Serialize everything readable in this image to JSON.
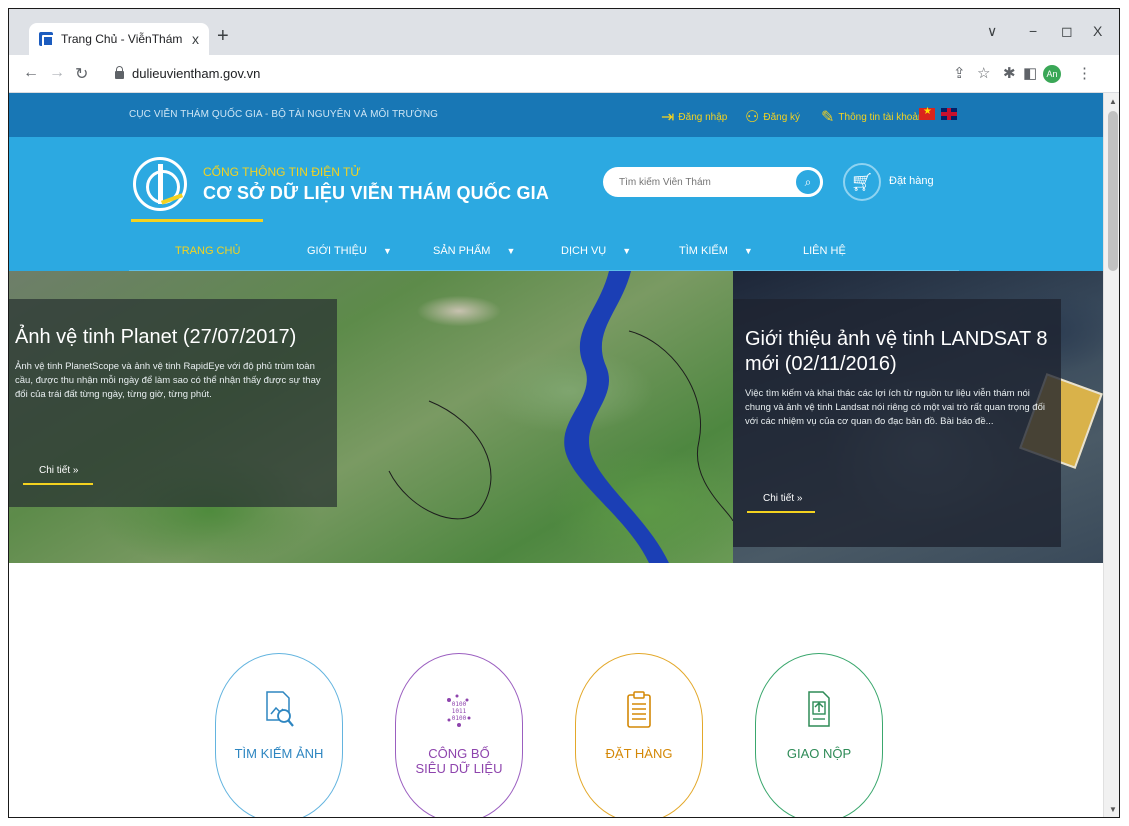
{
  "browser": {
    "tab_title": "Trang Chủ - ViễnThám",
    "tab_close": "x",
    "new_tab": "+",
    "url": "dulieuvientham.gov.vn",
    "avatar": "An",
    "window_controls": [
      "∨",
      "−",
      "◻",
      "X"
    ]
  },
  "topbar": {
    "agency": "CỤC VIỄN THÁM QUỐC GIA - BỘ TÀI NGUYÊN VÀ MÔI TRƯỜNG",
    "login": "Đăng nhập",
    "register": "Đăng ký",
    "account": "Thông tin tài khoản"
  },
  "header": {
    "portal_sub": "CỔNG THÔNG TIN ĐIỆN TỬ",
    "portal_title": "CƠ SỞ DỮ LIỆU VIỄN THÁM QUỐC GIA",
    "search_placeholder": "Tìm kiếm Viễn Thám",
    "order": "Đặt hàng"
  },
  "menu": [
    {
      "label": "TRANG CHỦ"
    },
    {
      "label": "GIỚI THIỆU"
    },
    {
      "label": "SẢN PHẨM"
    },
    {
      "label": "DỊCH VỤ"
    },
    {
      "label": "TÌM KIẾM"
    },
    {
      "label": "LIÊN HỆ"
    }
  ],
  "hero": {
    "left": {
      "title": "Ảnh vệ tinh Planet (27/07/2017)",
      "text": "Ảnh vệ tinh PlanetScope và ảnh vệ tinh RapidEye với độ phủ trùm toàn cầu, được thu nhận mỗi ngày để làm sao có thể nhận thấy được sự thay đổi của trái đất từng ngày, từng giờ, từng phút.",
      "more": "Chi tiết »"
    },
    "right": {
      "title": "Giới thiệu ảnh vệ tinh LANDSAT 8 mới (02/11/2016)",
      "text": "Việc tìm kiếm và khai thác các lợi ích từ nguồn tư liệu viễn thám nói chung và ảnh vệ tinh Landsat nói riêng có một vai trò rất quan trọng đối với các nhiệm vụ của cơ quan đo đạc bản đồ. Bài báo đề...",
      "more": "Chi tiết »"
    }
  },
  "features": [
    {
      "label": "TÌM KIẾM ẢNH",
      "color": "#2e86c1"
    },
    {
      "label_line1": "CÔNG BỐ",
      "label_line2": "SIÊU DỮ LIỆU",
      "color": "#8e44ad"
    },
    {
      "label": "ĐẶT HÀNG",
      "color": "#d48806"
    },
    {
      "label": "GIAO NỘP",
      "color": "#2e8b57"
    }
  ]
}
